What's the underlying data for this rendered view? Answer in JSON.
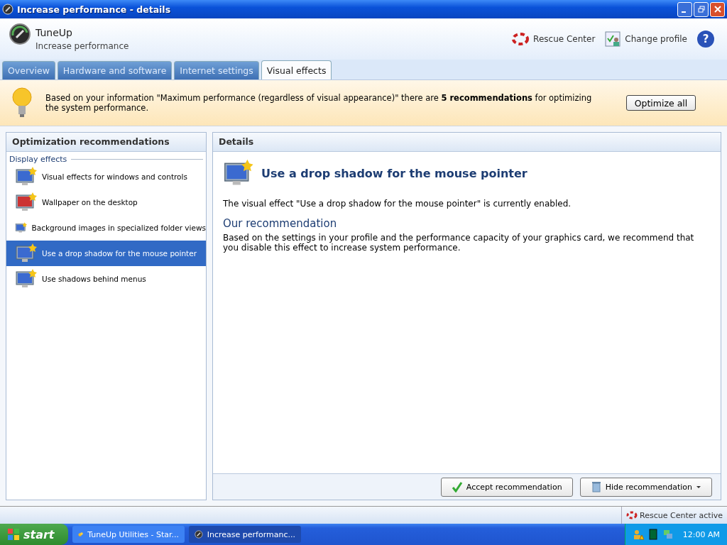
{
  "window": {
    "title": "Increase performance - details"
  },
  "header": {
    "app_name": "TuneUp",
    "subtitle": "Increase performance",
    "links": [
      "Rescue Center",
      "Change profile"
    ],
    "help": "?"
  },
  "tabs": [
    {
      "label": "Overview",
      "selected": false
    },
    {
      "label": "Hardware and software",
      "selected": false
    },
    {
      "label": "Internet settings",
      "selected": false
    },
    {
      "label": "Visual effects",
      "selected": true
    }
  ],
  "banner": {
    "text": "Based on your information \"Maximum performance (regardless of visual appearance)\" there are **5 recommendations** for optimizing the system performance.",
    "button": "Optimize all"
  },
  "recommendations": {
    "title": "Optimization recommendations",
    "group": "Display effects",
    "items": [
      {
        "label": "Visual effects for windows and controls",
        "selected": false
      },
      {
        "label": "Wallpaper on the desktop",
        "selected": false
      },
      {
        "label": "Background images in specialized folder views",
        "selected": false
      },
      {
        "label": "Use a drop shadow for the mouse pointer",
        "selected": true
      },
      {
        "label": "Use shadows behind menus",
        "selected": false
      }
    ]
  },
  "details": {
    "title": "Details",
    "heading": "Use a drop shadow for the mouse pointer",
    "status": "The visual effect \"Use a drop shadow for the mouse pointer\" is currently enabled.",
    "recommendation_title": "Our recommendation",
    "recommendation": "Based on the settings in your profile and the performance capacity of your graphics card, we recommend that you disable this effect to increase system performance.",
    "buttons": [
      "Accept recommendation",
      "Hide recommendation"
    ]
  },
  "status_bar": {
    "text": "Rescue Center active"
  },
  "taskbar": {
    "start": "start",
    "items": [
      {
        "label": "TuneUp Utilities - Star...",
        "selected": false
      },
      {
        "label": "Increase performanc...",
        "selected": true
      }
    ],
    "clock": "12:00 AM"
  }
}
